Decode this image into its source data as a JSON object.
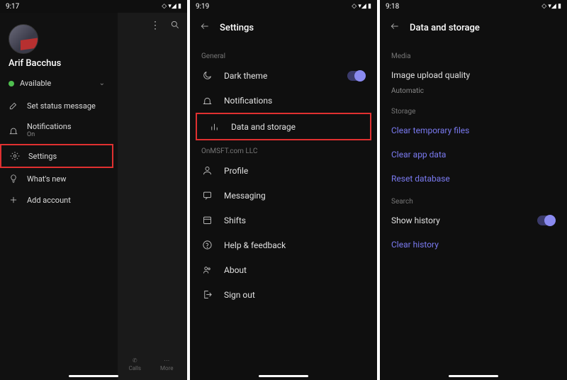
{
  "pane1": {
    "time": "9:17",
    "user_name": "Arif Bacchus",
    "presence": "Available",
    "items": {
      "status": "Set status message",
      "notifications": "Notifications",
      "notifications_sub": "On",
      "settings": "Settings",
      "whatsnew": "What's new",
      "addaccount": "Add account"
    },
    "bottom": {
      "calls": "Calls",
      "more": "More"
    }
  },
  "pane2": {
    "time": "9:19",
    "title": "Settings",
    "sections": {
      "general": "General",
      "org": "OnMSFT.com LLC"
    },
    "items": {
      "darktheme": "Dark theme",
      "notifications": "Notifications",
      "datastorage": "Data and storage",
      "profile": "Profile",
      "messaging": "Messaging",
      "shifts": "Shifts",
      "help": "Help & feedback",
      "about": "About",
      "signout": "Sign out"
    }
  },
  "pane3": {
    "time": "9:18",
    "title": "Data and storage",
    "sections": {
      "media": "Media",
      "storage": "Storage",
      "search": "Search"
    },
    "items": {
      "upload": "Image upload quality",
      "upload_val": "Automatic",
      "cleartemp": "Clear temporary files",
      "clearapp": "Clear app data",
      "resetdb": "Reset database",
      "showhist": "Show history",
      "clearhist": "Clear history"
    }
  }
}
